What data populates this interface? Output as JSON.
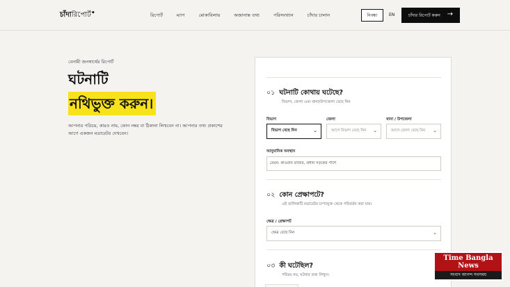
{
  "header": {
    "logo_bold": "চাঁদা",
    "logo_light": "রিপোর্ট",
    "logo_mark": "•",
    "nav": [
      "রিপোর্ট",
      "ম্যাপ",
      "মোকাবিলায়",
      "অজানান্ত তথ্য",
      "পরিসংখ্যান",
      "চাঁদার চালান"
    ],
    "login_label": "নিবন্ধ্য",
    "lang_label": "EN",
    "cta_label": "চাঁদার রিপোর্ট করুন",
    "cta_icon": "arrow-right-icon"
  },
  "hero": {
    "eyebrow": "বেনামী জনস্বার্থের রিপোর্ট",
    "title_line1": "ঘটনাটি",
    "title_line2": "নথিভুক্ত করুন।",
    "lede": "আপনার পরিচয়, কারও নাম, ফোন নম্বর বা ঠিকানা লিখবেন না। আপনার তথ্য প্রকাশের আগে একজন মডারেটর দেখবেন।",
    "highlight_color": "#f7e21c"
  },
  "form": {
    "step1": {
      "num": "০১",
      "title": "ঘটনাটি কোথায় ঘটেছে?",
      "hint": "বিভাগ, জেলা এবং থানা/উপজেলা বেছে নিন",
      "division_label": "বিভাগ",
      "division_value": "বিভাগ বেছে নিন",
      "district_label": "জেলা",
      "district_value": "আগে বিভাগ বেছে নিন",
      "thana_label": "থানা / উপজেলা",
      "thana_value": "আগে জেলা বেছে নিন",
      "location_label": "আনুমানিক অবস্থান",
      "location_value": "যেমন: কাওরান বাজার, প্রধান সড়কের পাশে"
    },
    "step2": {
      "num": "০২",
      "title": "কোন প্রেক্ষাপটে?",
      "hint": "এই তালিকাটি মডারেটর চাপ্যামুক্ত থেকে পরিবর্তন করা যায়।",
      "sector_label": "ক্ষেত্র / প্রেক্ষাপট",
      "sector_value": "ক্ষেত্র বেছে নিন"
    },
    "step3": {
      "num": "০৩",
      "title": "কী ঘটেছিল?",
      "hint": "পরিচয় নয়, ঘটনার তথ্য লিখুন।"
    }
  },
  "watermark": {
    "line1": "Time Bangla",
    "line2": "News",
    "sub": "সংবাদ আনন্দ সবসময়",
    "color": "#b01216"
  }
}
